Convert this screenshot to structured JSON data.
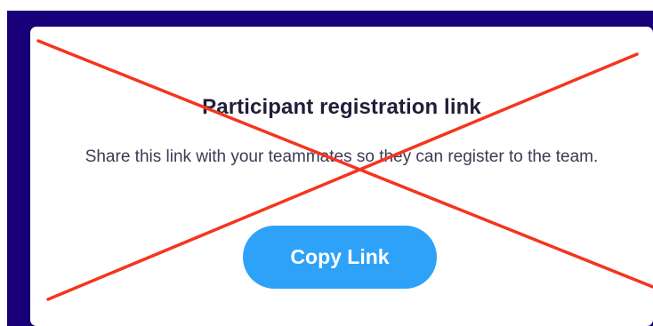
{
  "card": {
    "title": "Participant registration link",
    "description": "Share this link with your teammates so they can register to the team.",
    "copy_button_label": "Copy Link"
  },
  "overlay": {
    "icon": "red-cross-mark",
    "color": "#f4361e"
  },
  "colors": {
    "backdrop": "#17007a",
    "accent": "#2ea2f8",
    "title": "#1f1f3a"
  }
}
